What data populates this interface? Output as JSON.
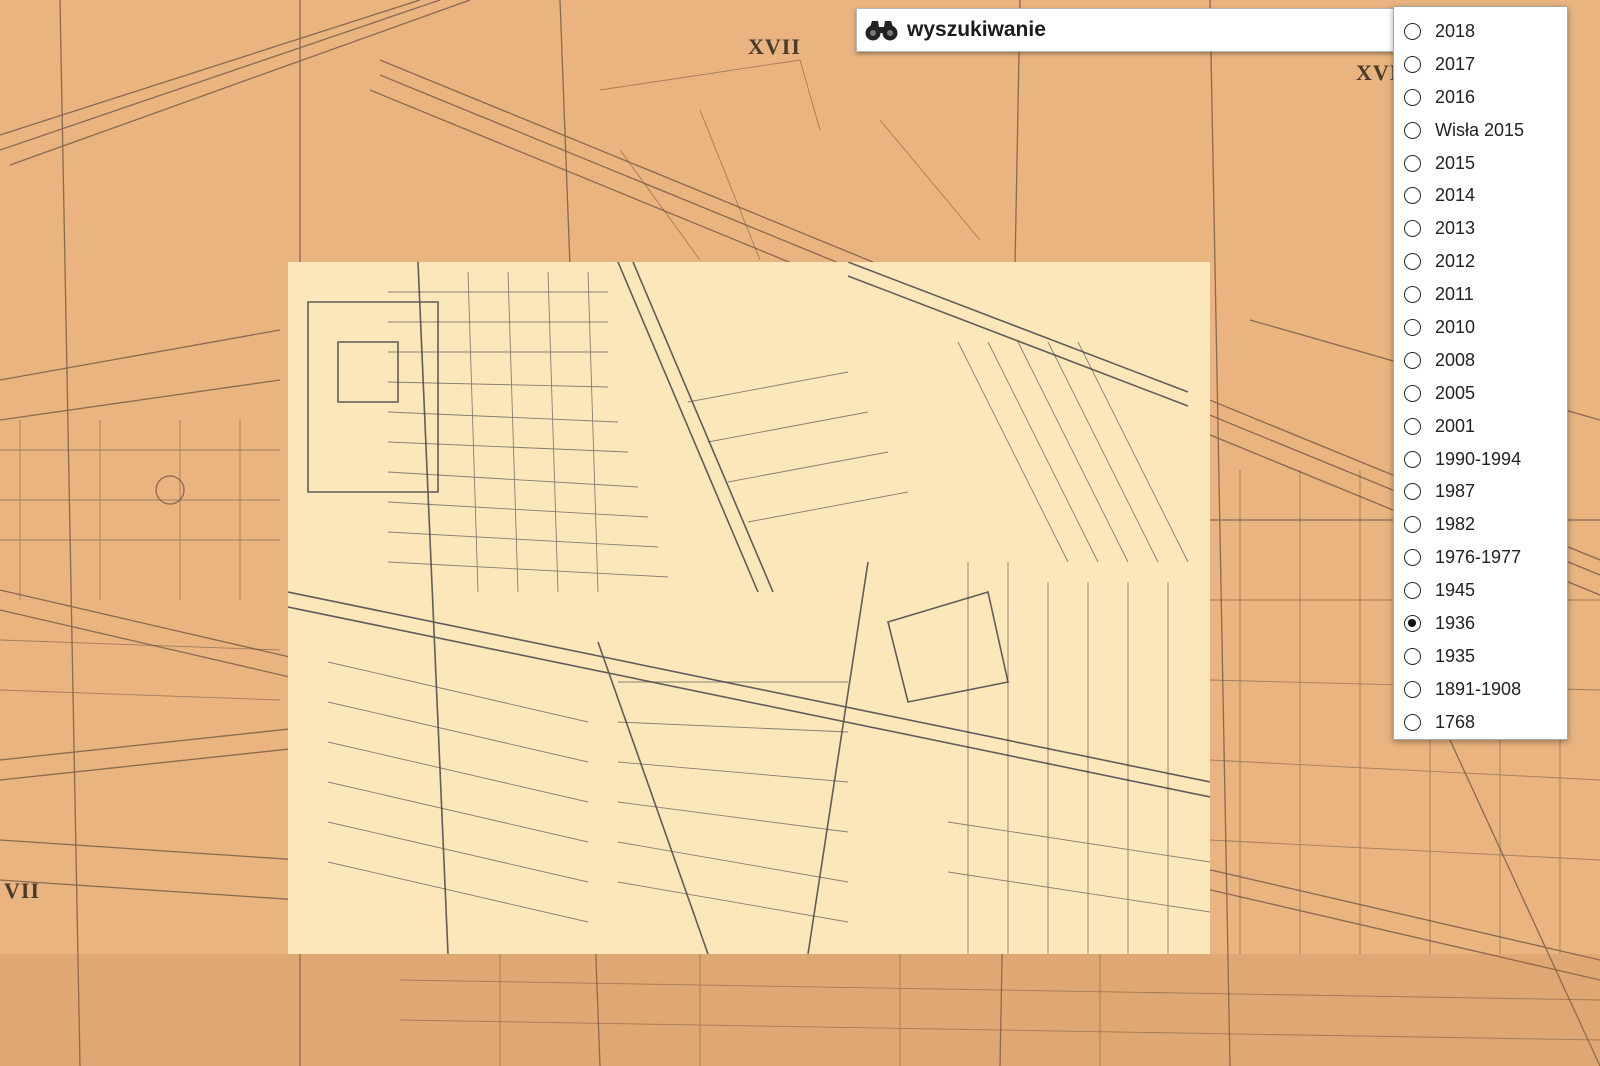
{
  "map": {
    "grid_labels": [
      "XVII",
      "XVI",
      "VII"
    ]
  },
  "search": {
    "label": "wyszukiwanie",
    "icon": "binoculars-icon"
  },
  "years": {
    "selected": "1936",
    "items": [
      {
        "label": "2018",
        "checked": false
      },
      {
        "label": "2017",
        "checked": false
      },
      {
        "label": "2016",
        "checked": false
      },
      {
        "label": "Wisła 2015",
        "checked": false
      },
      {
        "label": "2015",
        "checked": false
      },
      {
        "label": "2014",
        "checked": false
      },
      {
        "label": "2013",
        "checked": false
      },
      {
        "label": "2012",
        "checked": false
      },
      {
        "label": "2011",
        "checked": false
      },
      {
        "label": "2010",
        "checked": false
      },
      {
        "label": "2008",
        "checked": false
      },
      {
        "label": "2005",
        "checked": false
      },
      {
        "label": "2001",
        "checked": false
      },
      {
        "label": "1990-1994",
        "checked": false
      },
      {
        "label": "1987",
        "checked": false
      },
      {
        "label": "1982",
        "checked": false
      },
      {
        "label": "1976-1977",
        "checked": false
      },
      {
        "label": "1945",
        "checked": false
      },
      {
        "label": "1936",
        "checked": true
      },
      {
        "label": "1935",
        "checked": false
      },
      {
        "label": "1891-1908",
        "checked": false
      },
      {
        "label": "1768",
        "checked": false
      }
    ]
  },
  "colors": {
    "map_background": "#e9b47f",
    "loaded_tile": "#fbe7b9",
    "ink": "#3d3a44"
  }
}
